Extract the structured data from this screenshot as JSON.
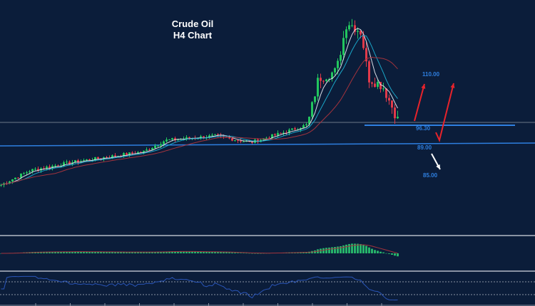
{
  "chart_data": {
    "type": "candlestick",
    "title": "Crude Oil",
    "subtitle": "H4 Chart",
    "price_path": [
      [
        0,
        73.4
      ],
      [
        40,
        78.8
      ],
      [
        100,
        82.0
      ],
      [
        200,
        86.0
      ],
      [
        230,
        90.3
      ],
      [
        300,
        92.0
      ],
      [
        350,
        89.5
      ],
      [
        400,
        93.6
      ],
      [
        430,
        96.3
      ],
      [
        445,
        113.9
      ],
      [
        470,
        116.6
      ],
      [
        485,
        135.5
      ],
      [
        505,
        131.4
      ],
      [
        515,
        113.9
      ],
      [
        535,
        111.0
      ],
      [
        558,
        97.0
      ]
    ],
    "price_path_units": [
      "bar index (x4)",
      "USD"
    ],
    "current_price_line": 97.1,
    "levels": [
      {
        "label": "110.00",
        "value": 110.0
      },
      {
        "label": "96.30",
        "value": 96.3
      },
      {
        "label": "89.00",
        "value": 89.0
      },
      {
        "label": "85.00",
        "value": 85.0
      }
    ],
    "scenarios": [
      {
        "name": "bounce-up",
        "from": 96.3,
        "to": 110.0,
        "color": "#e8232b"
      },
      {
        "name": "dip-then-rally",
        "from": 96.3,
        "via": 89.0,
        "to": 110.0,
        "color": "#e8232b"
      },
      {
        "name": "breakdown",
        "from": 89.0,
        "to": 85.0,
        "color": "#ffffff"
      }
    ],
    "indicators": [
      "MACD histogram",
      "RSI"
    ],
    "rsi_levels": [
      70,
      30
    ],
    "colors": {
      "bull": "#22c55e",
      "bear": "#e03a4a",
      "bg": "#0b1d3a",
      "level": "#2e7fe0"
    }
  }
}
